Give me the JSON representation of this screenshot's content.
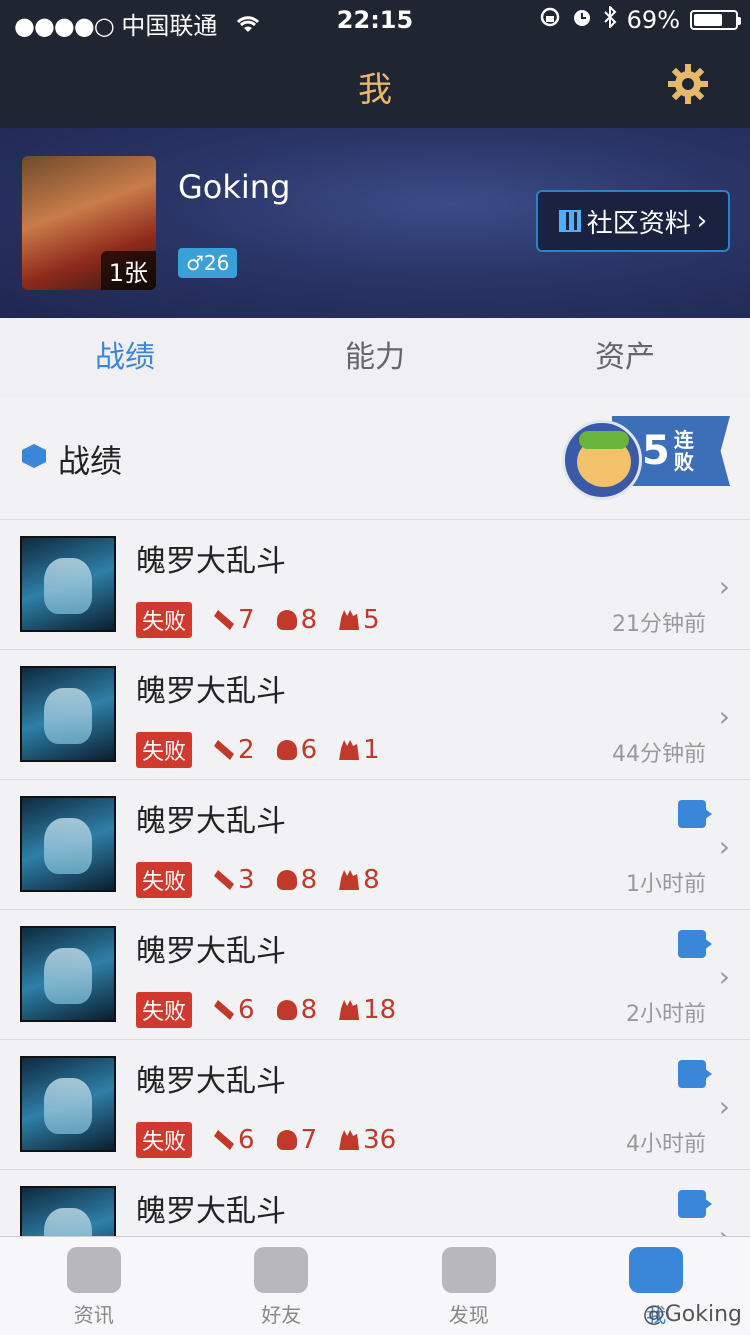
{
  "status_bar": {
    "signal": "●●●●○",
    "carrier": "中国联通",
    "time": "22:15",
    "battery": "69%",
    "battery_level": 0.69
  },
  "header": {
    "title": "我"
  },
  "profile": {
    "avatar_count": "1张",
    "username": "Goking",
    "gender_level": "♂26",
    "community_label": "社区资料"
  },
  "tabs": [
    {
      "label": "战绩",
      "active": true
    },
    {
      "label": "能力",
      "active": false
    },
    {
      "label": "资产",
      "active": false
    }
  ],
  "section": {
    "title": "战绩",
    "streak_number": "5",
    "streak_text": "连败"
  },
  "matches": [
    {
      "mode": "魄罗大乱斗",
      "result": "失败",
      "kills": "7",
      "deaths": "8",
      "assists": "5",
      "time": "21分钟前",
      "video": false
    },
    {
      "mode": "魄罗大乱斗",
      "result": "失败",
      "kills": "2",
      "deaths": "6",
      "assists": "1",
      "time": "44分钟前",
      "video": false
    },
    {
      "mode": "魄罗大乱斗",
      "result": "失败",
      "kills": "3",
      "deaths": "8",
      "assists": "8",
      "time": "1小时前",
      "video": true
    },
    {
      "mode": "魄罗大乱斗",
      "result": "失败",
      "kills": "6",
      "deaths": "8",
      "assists": "18",
      "time": "2小时前",
      "video": true
    },
    {
      "mode": "魄罗大乱斗",
      "result": "失败",
      "kills": "6",
      "deaths": "7",
      "assists": "36",
      "time": "4小时前",
      "video": true
    },
    {
      "mode": "魄罗大乱斗",
      "result": "",
      "kills": "",
      "deaths": "",
      "assists": "",
      "time": "",
      "video": true
    }
  ],
  "tabbar": [
    {
      "label": "资讯",
      "active": false
    },
    {
      "label": "好友",
      "active": false
    },
    {
      "label": "发现",
      "active": false
    },
    {
      "label": "我",
      "active": true
    }
  ],
  "watermark": "@Goking"
}
